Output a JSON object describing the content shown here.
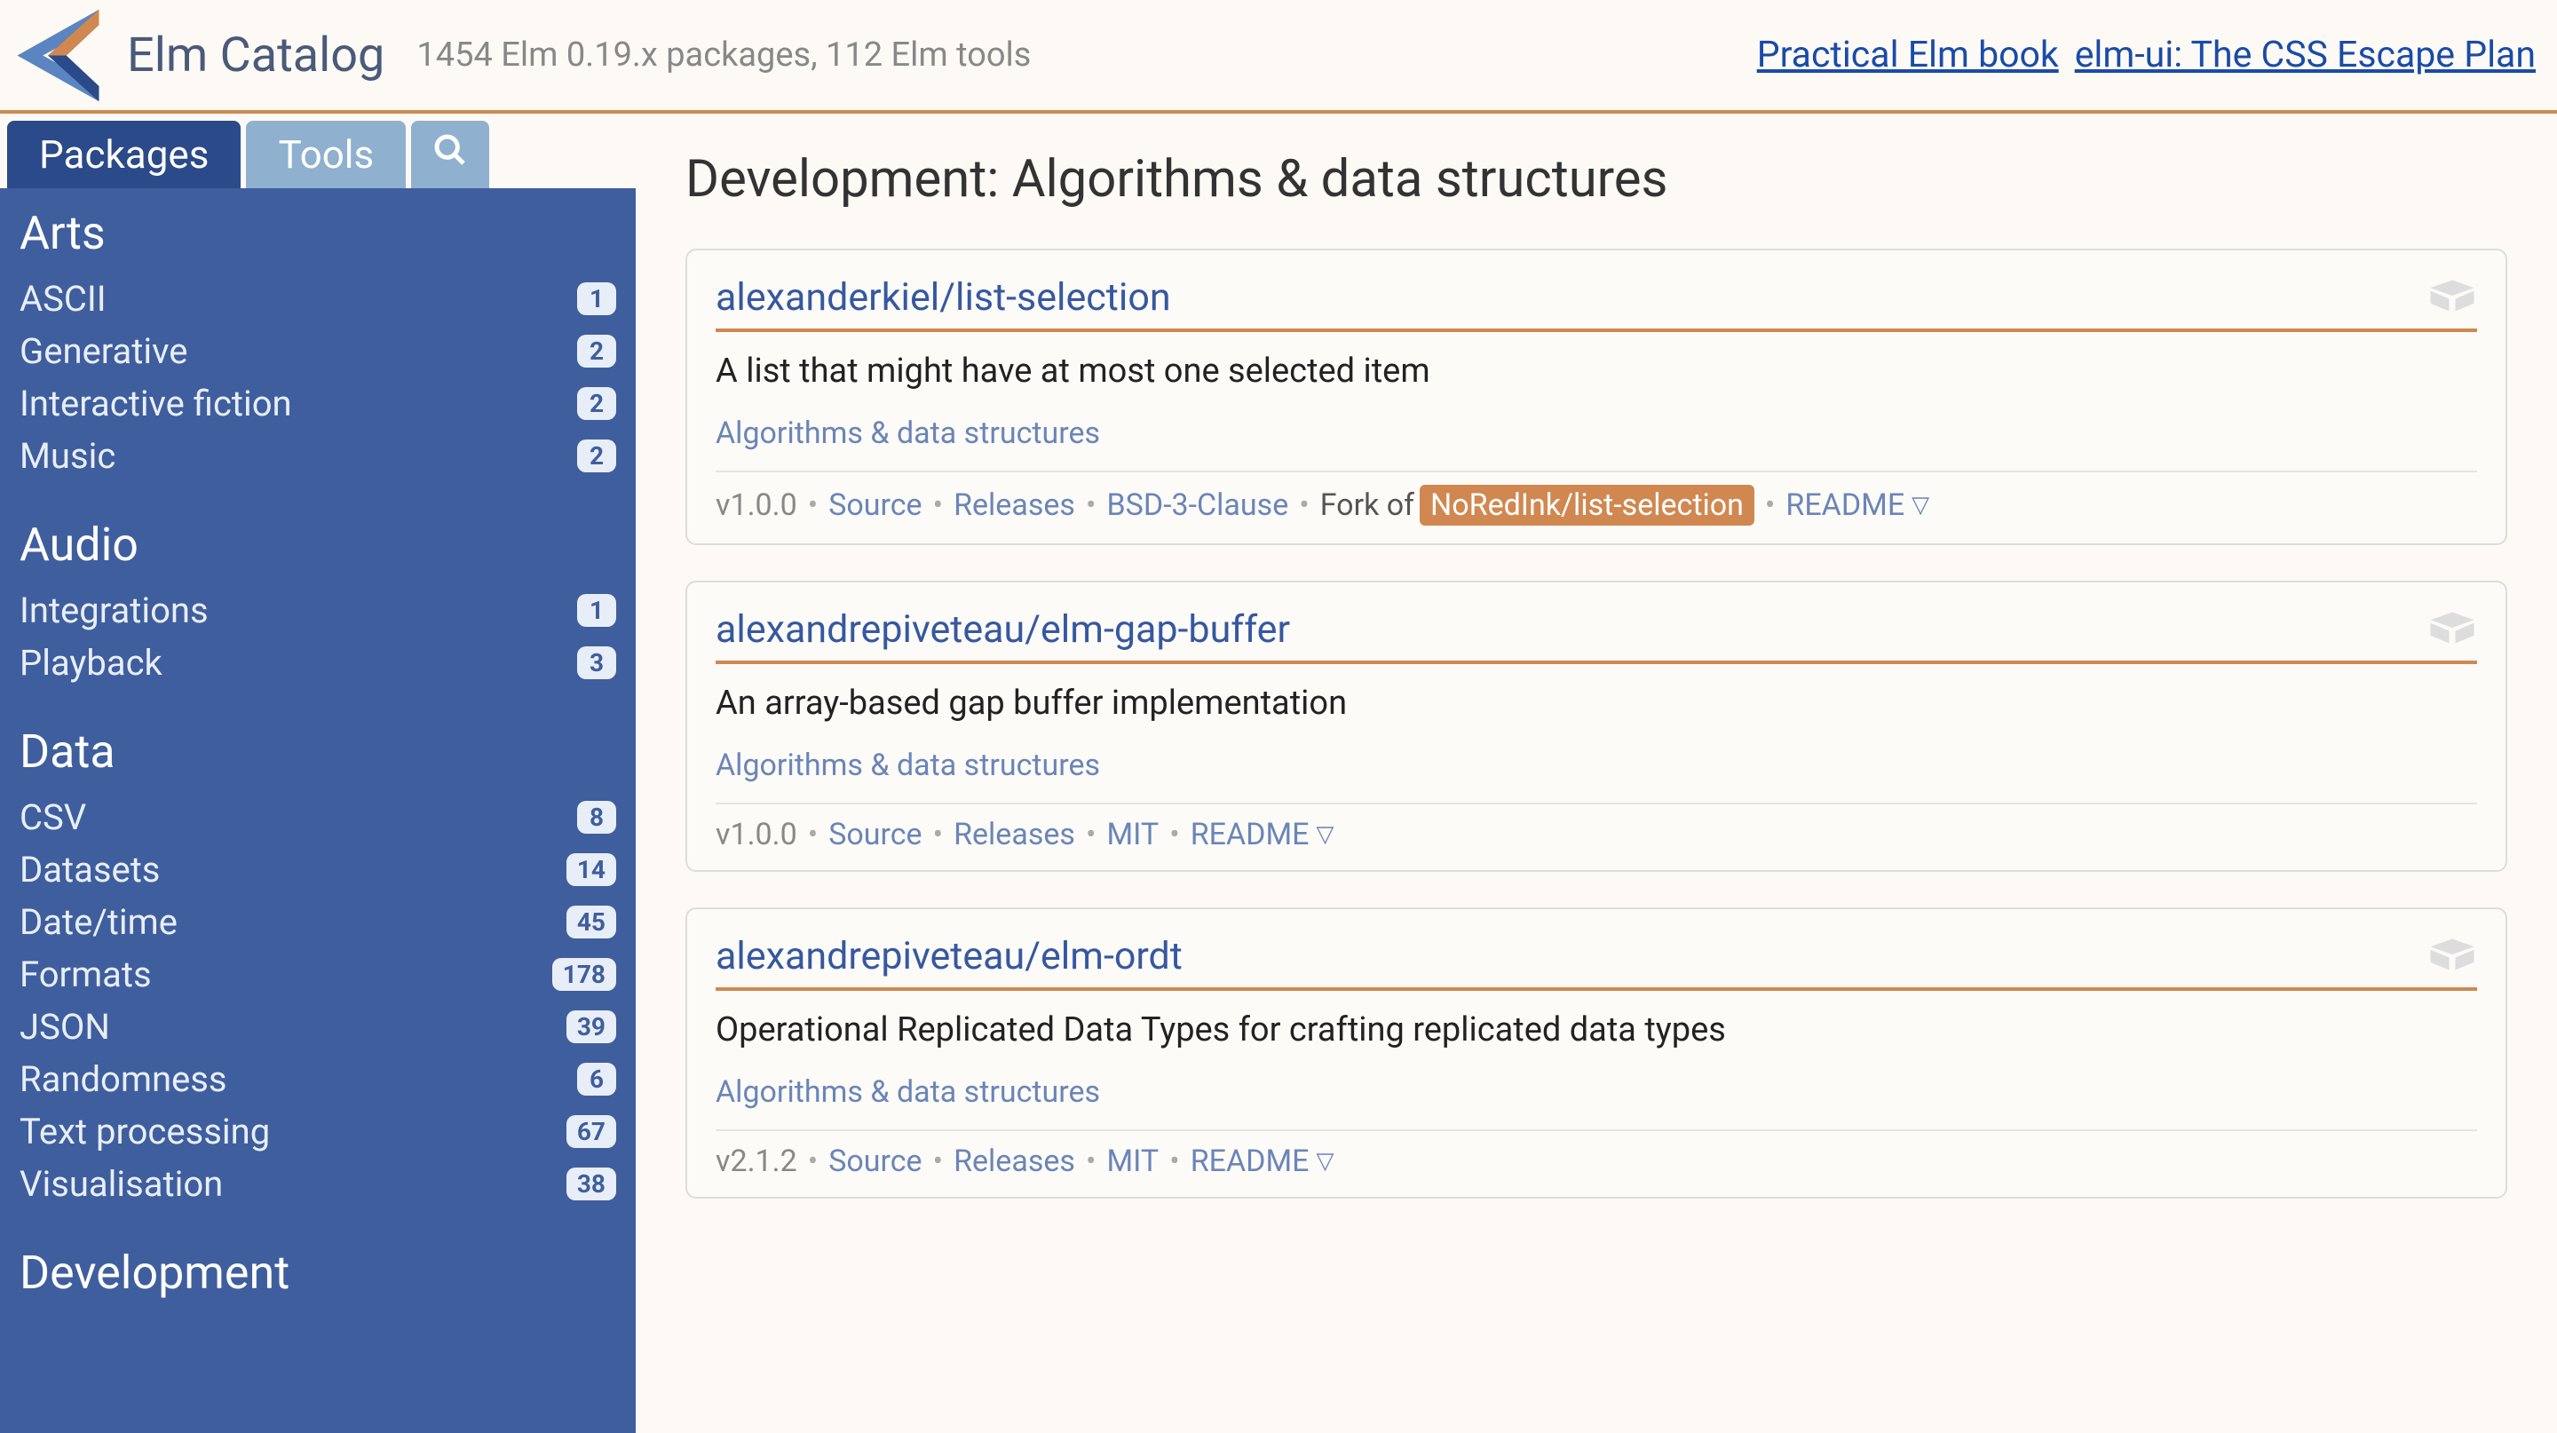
{
  "header": {
    "title": "Elm Catalog",
    "subtitle": "1454 Elm 0.19.x packages, 112 Elm tools",
    "links": [
      {
        "label": "Practical Elm book"
      },
      {
        "label": "elm-ui: The CSS Escape Plan"
      }
    ]
  },
  "tabs": {
    "packages": "Packages",
    "tools": "Tools"
  },
  "sidebar": [
    {
      "title": "Arts",
      "items": [
        {
          "label": "ASCII",
          "count": "1"
        },
        {
          "label": "Generative",
          "count": "2"
        },
        {
          "label": "Interactive fiction",
          "count": "2"
        },
        {
          "label": "Music",
          "count": "2"
        }
      ]
    },
    {
      "title": "Audio",
      "items": [
        {
          "label": "Integrations",
          "count": "1"
        },
        {
          "label": "Playback",
          "count": "3"
        }
      ]
    },
    {
      "title": "Data",
      "items": [
        {
          "label": "CSV",
          "count": "8"
        },
        {
          "label": "Datasets",
          "count": "14"
        },
        {
          "label": "Date/time",
          "count": "45"
        },
        {
          "label": "Formats",
          "count": "178"
        },
        {
          "label": "JSON",
          "count": "39"
        },
        {
          "label": "Randomness",
          "count": "6"
        },
        {
          "label": "Text processing",
          "count": "67"
        },
        {
          "label": "Visualisation",
          "count": "38"
        }
      ]
    },
    {
      "title": "Development",
      "items": []
    }
  ],
  "main": {
    "title": "Development: Algorithms & data structures"
  },
  "packages": [
    {
      "name": "alexanderkiel/list-selection",
      "description": "A list that might have at most one selected item",
      "tag": "Algorithms & data structures",
      "version": "v1.0.0",
      "license": "BSD-3-Clause",
      "fork_of": "NoRedInk/list-selection",
      "source_label": "Source",
      "releases_label": "Releases",
      "readme_label": "README",
      "fork_prefix": "Fork of"
    },
    {
      "name": "alexandrepiveteau/elm-gap-buffer",
      "description": "An array-based gap buffer implementation",
      "tag": "Algorithms & data structures",
      "version": "v1.0.0",
      "license": "MIT",
      "source_label": "Source",
      "releases_label": "Releases",
      "readme_label": "README"
    },
    {
      "name": "alexandrepiveteau/elm-ordt",
      "description": "Operational Replicated Data Types for crafting replicated data types",
      "tag": "Algorithms & data structures",
      "version": "v2.1.2",
      "license": "MIT",
      "source_label": "Source",
      "releases_label": "Releases",
      "readme_label": "README"
    }
  ]
}
